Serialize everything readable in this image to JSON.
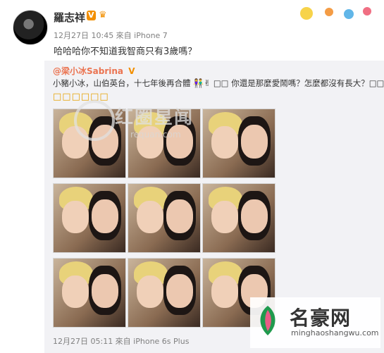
{
  "post": {
    "username": "羅志祥",
    "vip_badge": "V",
    "meta": "12月27日 10:45 來自 iPhone 7",
    "text": "哈哈哈你不知道我智商只有3歲嗎？"
  },
  "repost": {
    "author": "@梁小冰Sabrina",
    "author_badge": "V",
    "text": "小豬小冰，山伯英台，十七年後再合體",
    "text_tail": "□□ 你還是那麼愛鬧嗎？怎麼都沒有長大？□□□",
    "emoji_row": "□□□□□□",
    "bottom_meta": "12月27日 05:11 來自 iPhone 6s Plus"
  },
  "watermark": {
    "title": "红圈星闻",
    "sub": "requan.com"
  },
  "logo": {
    "title": "名豪网",
    "url": "minghaoshangwu.com"
  },
  "colors": {
    "accent": "#eb7350",
    "vip": "#f28f00",
    "meta": "#808080",
    "panel": "#f2f2f5"
  }
}
